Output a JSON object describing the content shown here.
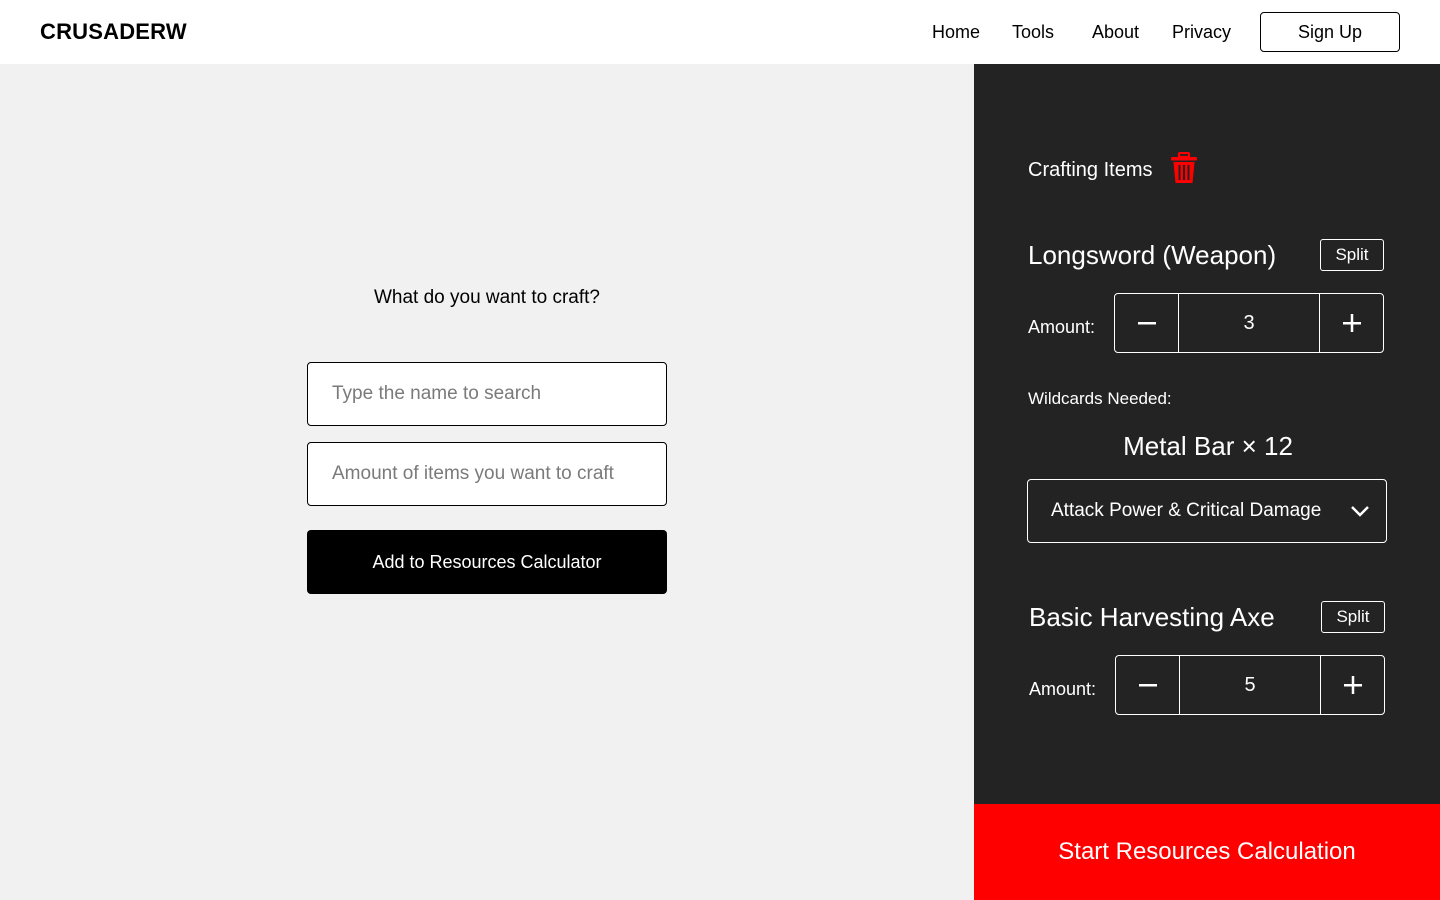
{
  "header": {
    "brand": "CRUSADERW",
    "nav": {
      "home": "Home",
      "tools": "Tools",
      "about": "About",
      "privacy": "Privacy"
    },
    "signup_label": "Sign Up"
  },
  "main": {
    "question": "What do you want to craft?",
    "search_placeholder": "Type the name to search",
    "amount_placeholder": "Amount of items you want to craft",
    "add_button": "Add to Resources Calculator"
  },
  "panel": {
    "title": "Crafting Items",
    "trash_icon": "trash-icon",
    "accent_color": "#ff0000",
    "items": [
      {
        "name": "Longsword (Weapon)",
        "split_label": "Split",
        "amount_label": "Amount:",
        "amount": "3"
      },
      {
        "name": "Basic Harvesting Axe",
        "split_label": "Split",
        "amount_label": "Amount:",
        "amount": "5"
      }
    ],
    "wildcards_label": "Wildcards Needed:",
    "wildcards_value": "Metal Bar × 12",
    "wildcard_selection": "Attack Power & Critical Damage",
    "start_button": "Start Resources Calculation"
  }
}
